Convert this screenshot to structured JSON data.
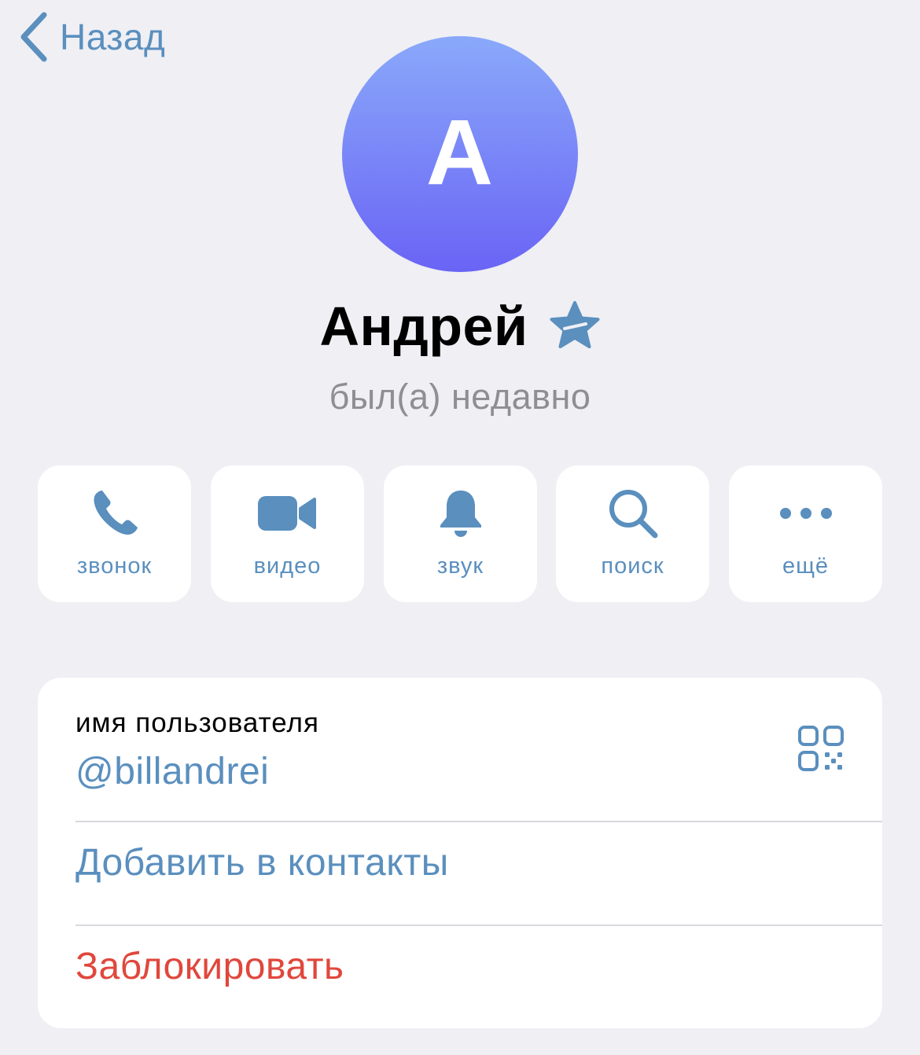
{
  "nav": {
    "back_label": "Назад"
  },
  "profile": {
    "avatar_letter": "A",
    "name": "Андрей",
    "status": "был(а) недавно"
  },
  "actions": [
    {
      "icon": "phone-icon",
      "label": "звонок"
    },
    {
      "icon": "video-camera-icon",
      "label": "видео"
    },
    {
      "icon": "bell-icon",
      "label": "звук"
    },
    {
      "icon": "search-icon",
      "label": "поиск"
    },
    {
      "icon": "more-dots-icon",
      "label": "ещё"
    }
  ],
  "info": {
    "username_caption": "имя пользователя",
    "username_value": "@billandrei",
    "add_contact_label": "Добавить в контакты",
    "block_label": "Заблокировать"
  },
  "colors": {
    "accent": "#5a8fbe",
    "danger": "#e0473c",
    "background": "#efeff4",
    "avatar_gradient_top": "#8aa9fa",
    "avatar_gradient_bottom": "#6a64f5"
  }
}
